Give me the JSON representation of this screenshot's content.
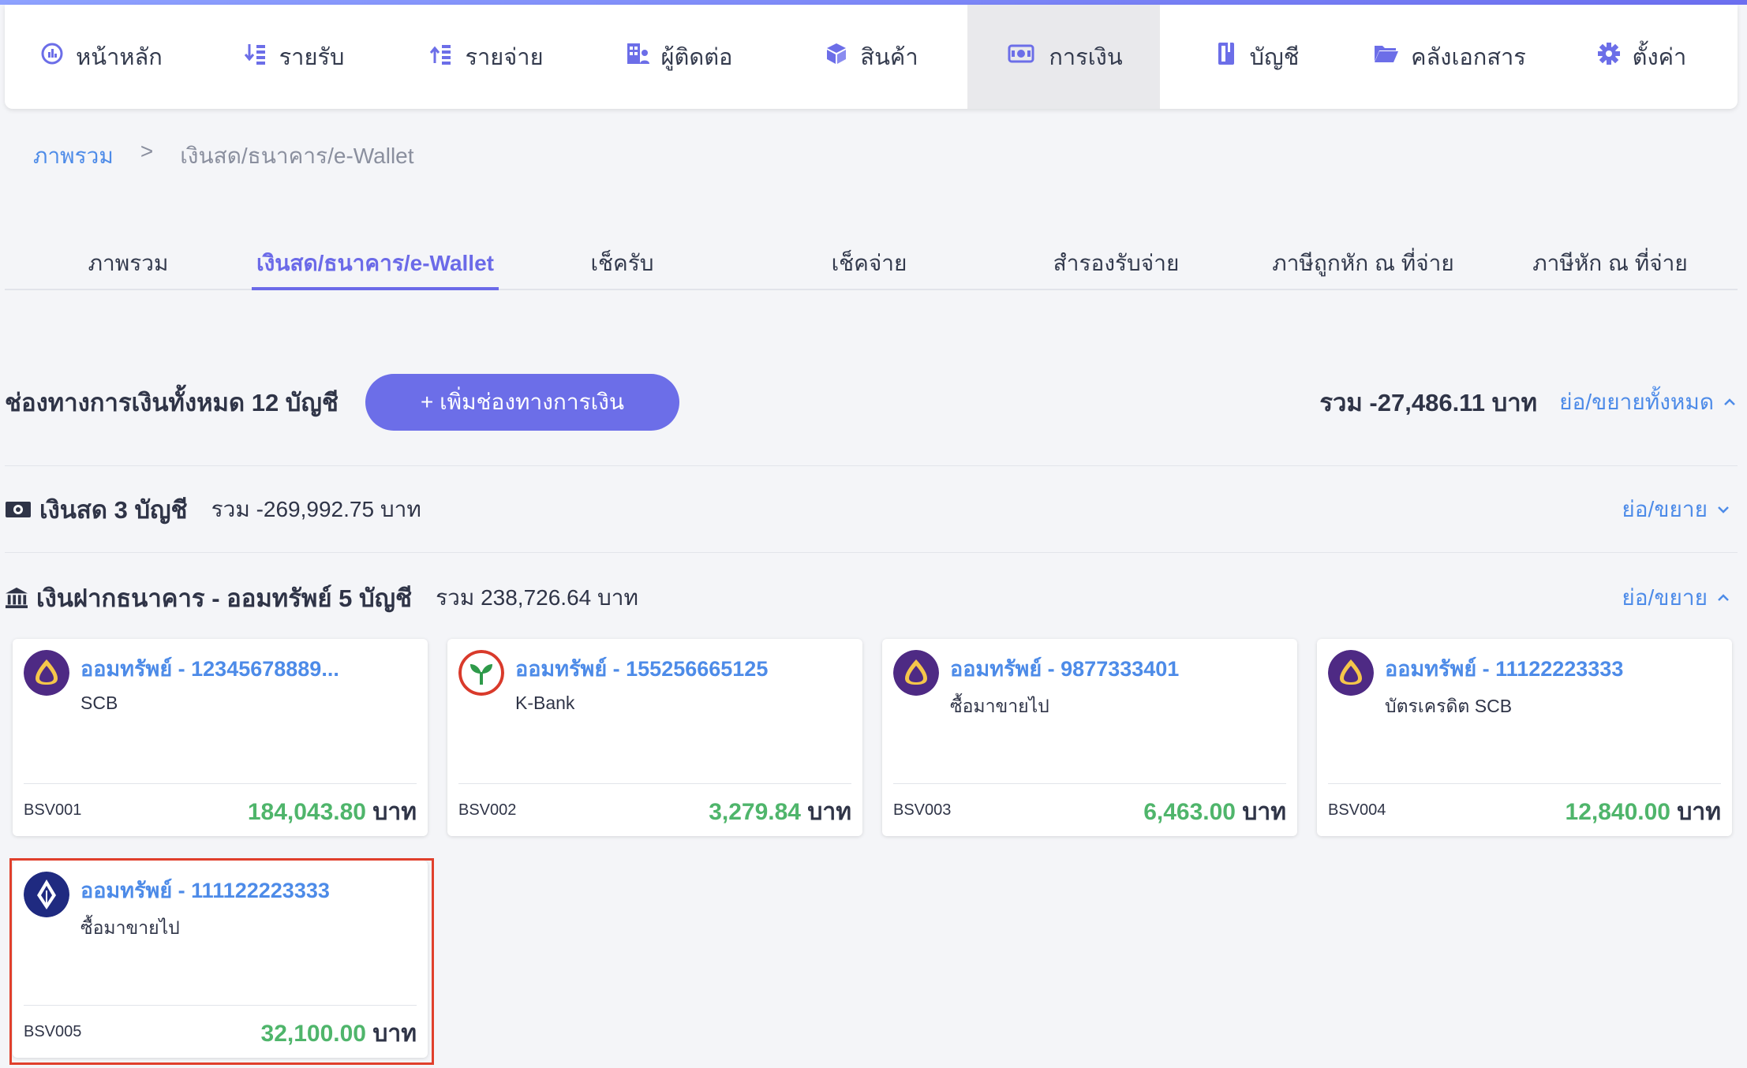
{
  "nav": [
    {
      "label": "หน้าหลัก",
      "icon": "dashboard-icon",
      "active": false
    },
    {
      "label": "รายรับ",
      "icon": "income-icon",
      "active": false
    },
    {
      "label": "รายจ่าย",
      "icon": "expense-icon",
      "active": false
    },
    {
      "label": "ผู้ติดต่อ",
      "icon": "contacts-icon",
      "active": false
    },
    {
      "label": "สินค้า",
      "icon": "product-box-icon",
      "active": false
    },
    {
      "label": "การเงิน",
      "icon": "money-icon",
      "active": true
    },
    {
      "label": "บัญชี",
      "icon": "ledger-book-icon",
      "active": false
    },
    {
      "label": "คลังเอกสาร",
      "icon": "folder-icon",
      "active": false
    },
    {
      "label": "ตั้งค่า",
      "icon": "gear-icon",
      "active": false
    }
  ],
  "breadcrumb": {
    "root": "ภาพรวม",
    "separator": ">",
    "current": "เงินสด/ธนาคาร/e-Wallet"
  },
  "tabs": [
    {
      "label": "ภาพรวม",
      "active": false
    },
    {
      "label": "เงินสด/ธนาคาร/e-Wallet",
      "active": true
    },
    {
      "label": "เช็ครับ",
      "active": false
    },
    {
      "label": "เช็คจ่าย",
      "active": false
    },
    {
      "label": "สำรองรับจ่าย",
      "active": false
    },
    {
      "label": "ภาษีถูกหัก ณ ที่จ่าย",
      "active": false
    },
    {
      "label": "ภาษีหัก ณ ที่จ่าย",
      "active": false
    }
  ],
  "summary": {
    "title": "ช่องทางการเงินทั้งหมด 12 บัญชี",
    "add_button": "+ เพิ่มช่องทางการเงิน",
    "total": "รวม -27,486.11 บาท",
    "toggle_all": "ย่อ/ขยายทั้งหมด"
  },
  "cash_section": {
    "title": "เงินสด 3 บัญชี",
    "sum": "รวม -269,992.75 บาท",
    "toggle": "ย่อ/ขยาย"
  },
  "bank_section": {
    "title": "เงินฝากธนาคาร - ออมทรัพย์ 5 บัญชี",
    "sum": "รวม 238,726.64 บาท",
    "toggle": "ย่อ/ขยาย"
  },
  "accounts": [
    {
      "name": "ออมทรัพย์ - 12345678889...",
      "bank": "SCB",
      "code": "BSV001",
      "amount": "184,043.80",
      "unit": "บาท",
      "logo": "scb-logo-icon"
    },
    {
      "name": "ออมทรัพย์ - 155256665125",
      "bank": "K-Bank",
      "code": "BSV002",
      "amount": "3,279.84",
      "unit": "บาท",
      "logo": "kbank-logo-icon"
    },
    {
      "name": "ออมทรัพย์ - 9877333401",
      "bank": "ซื้อมาขายไป",
      "code": "BSV003",
      "amount": "6,463.00",
      "unit": "บาท",
      "logo": "scb-logo-icon"
    },
    {
      "name": "ออมทรัพย์ - 11122223333",
      "bank": "บัตรเครดิต SCB",
      "code": "BSV004",
      "amount": "12,840.00",
      "unit": "บาท",
      "logo": "scb-logo-icon"
    },
    {
      "name": "ออมทรัพย์ - 111122223333",
      "bank": "ซื้อมาขายไป",
      "code": "BSV005",
      "amount": "32,100.00",
      "unit": "บาท",
      "logo": "bbl-logo-icon"
    }
  ],
  "colors": {
    "accent": "#6c6ee8",
    "link": "#4d8be8",
    "amount": "#4fb56b",
    "highlight": "#e0402c"
  }
}
